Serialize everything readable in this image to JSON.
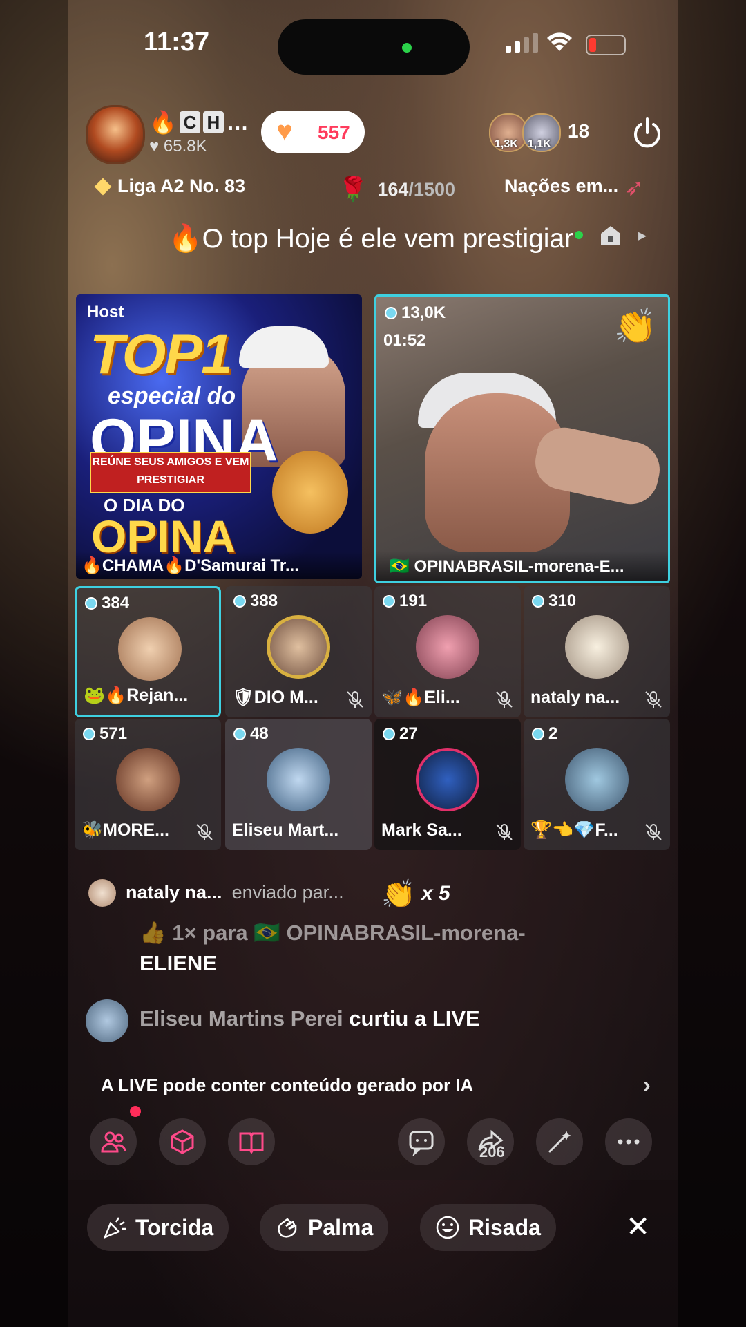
{
  "status": {
    "time": "11:37"
  },
  "header": {
    "host_name_letters": [
      "C",
      "H"
    ],
    "host_name_ellipsis": "…",
    "host_likes": "65.8K",
    "like_count": "557",
    "viewer_badges": [
      "1,3K",
      "1,1K"
    ],
    "viewer_count": "18"
  },
  "info_bar": {
    "liga": "Liga A2 No. 83",
    "goal_current": "164",
    "goal_total": "/1500",
    "nacoes": "Nações em..."
  },
  "banner": {
    "text": "O top Hoje é ele vem prestigiar"
  },
  "host_tile": {
    "label": "Host",
    "poster_top": "TOP1",
    "poster_especial": "especial do",
    "poster_opina": "OPINA",
    "poster_ribbon": "REÚNE SEUS AMIGOS E VEM PRESTIGIAR",
    "poster_dia": "O DIA DO",
    "poster_opina2": "OPINA",
    "caption": "🔥CHAMA🔥D'Samurai Tr..."
  },
  "guest_tile": {
    "count": "13,0K",
    "timer": "01:52",
    "caption": "🇧🇷 OPINABRASIL-morena-E..."
  },
  "seats": [
    {
      "count": "384",
      "name": "🐸🔥Rejan...",
      "muted": false
    },
    {
      "count": "388",
      "name": "🛡DIO M...",
      "muted": true
    },
    {
      "count": "191",
      "name": "🦋🔥Eli...",
      "muted": true
    },
    {
      "count": "310",
      "name": "nataly na...",
      "muted": true
    },
    {
      "count": "571",
      "name": "🐝MORE...",
      "muted": true
    },
    {
      "count": "48",
      "name": "Eliseu Mart...",
      "muted": false
    },
    {
      "count": "27",
      "name": "Mark Sa...",
      "muted": true
    },
    {
      "count": "2",
      "name": "🏆👈💎F...",
      "muted": true
    }
  ],
  "chat": {
    "msg1_user": "nataly na...",
    "msg1_text": "enviado par...",
    "msg1_mult": "x 5",
    "msg2_line1": "👍 1× para 🇧🇷 OPINABRASIL-morena-",
    "msg2_line2": "ELIENE",
    "msg3_user": "Eliseu Martins Perei",
    "msg3_text": "curtiu a LIVE"
  },
  "ai_notice": "A LIVE pode conter conteúdo gerado por IA",
  "toolbar": {
    "share_count": "206"
  },
  "reactions": [
    "Torcida",
    "Palma",
    "Risada"
  ],
  "colors": {
    "accent": "#3ed0e0",
    "like": "#ff3b5c",
    "notify": "#ff2d5a"
  }
}
